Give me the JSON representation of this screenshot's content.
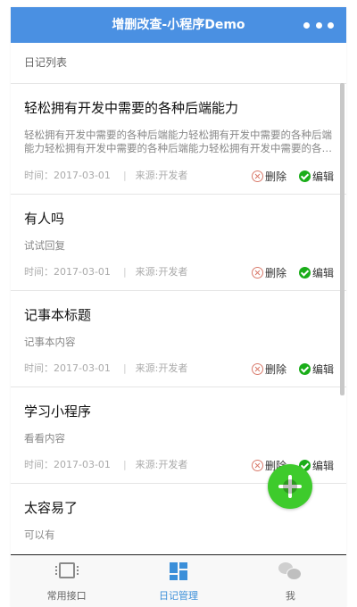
{
  "navbar": {
    "title": "增删改查-小程序Demo",
    "more_icon": "more-dots-icon"
  },
  "section": {
    "title": "日记列表"
  },
  "labels": {
    "time_prefix": "时间：",
    "source_prefix": "来源:",
    "delete": "删除",
    "edit": "编辑"
  },
  "entries": [
    {
      "title": "轻松拥有开发中需要的各种后端能力",
      "body": "轻松拥有开发中需要的各种后端能力轻松拥有开发中需要的各种后端能力轻松拥有开发中需要的各种后端能力轻松拥有开发中需要的各种后端能力",
      "date": "2017-03-01",
      "source": "开发者"
    },
    {
      "title": "有人吗",
      "body": "试试回复",
      "date": "2017-03-01",
      "source": "开发者"
    },
    {
      "title": "记事本标题",
      "body": "记事本内容",
      "date": "2017-03-01",
      "source": "开发者"
    },
    {
      "title": "学习小程序",
      "body": "看看内容",
      "date": "2017-03-01",
      "source": "开发者"
    },
    {
      "title": "太容易了",
      "body": "可以有",
      "date": "",
      "source": ""
    }
  ],
  "tabbar": {
    "tabs": [
      {
        "label": "常用接口",
        "icon": "chip-icon",
        "active": false
      },
      {
        "label": "日记管理",
        "icon": "grid-icon",
        "active": true
      },
      {
        "label": "我",
        "icon": "wechat-icon",
        "active": false
      }
    ]
  },
  "fab": {
    "icon": "plus-icon"
  },
  "colors": {
    "navbar": "#4a90e2",
    "accent_tab": "#3b8fd9",
    "fab": "#3ecb2c",
    "edit_icon": "#1aad19",
    "delete_icon": "#d97b6c"
  }
}
